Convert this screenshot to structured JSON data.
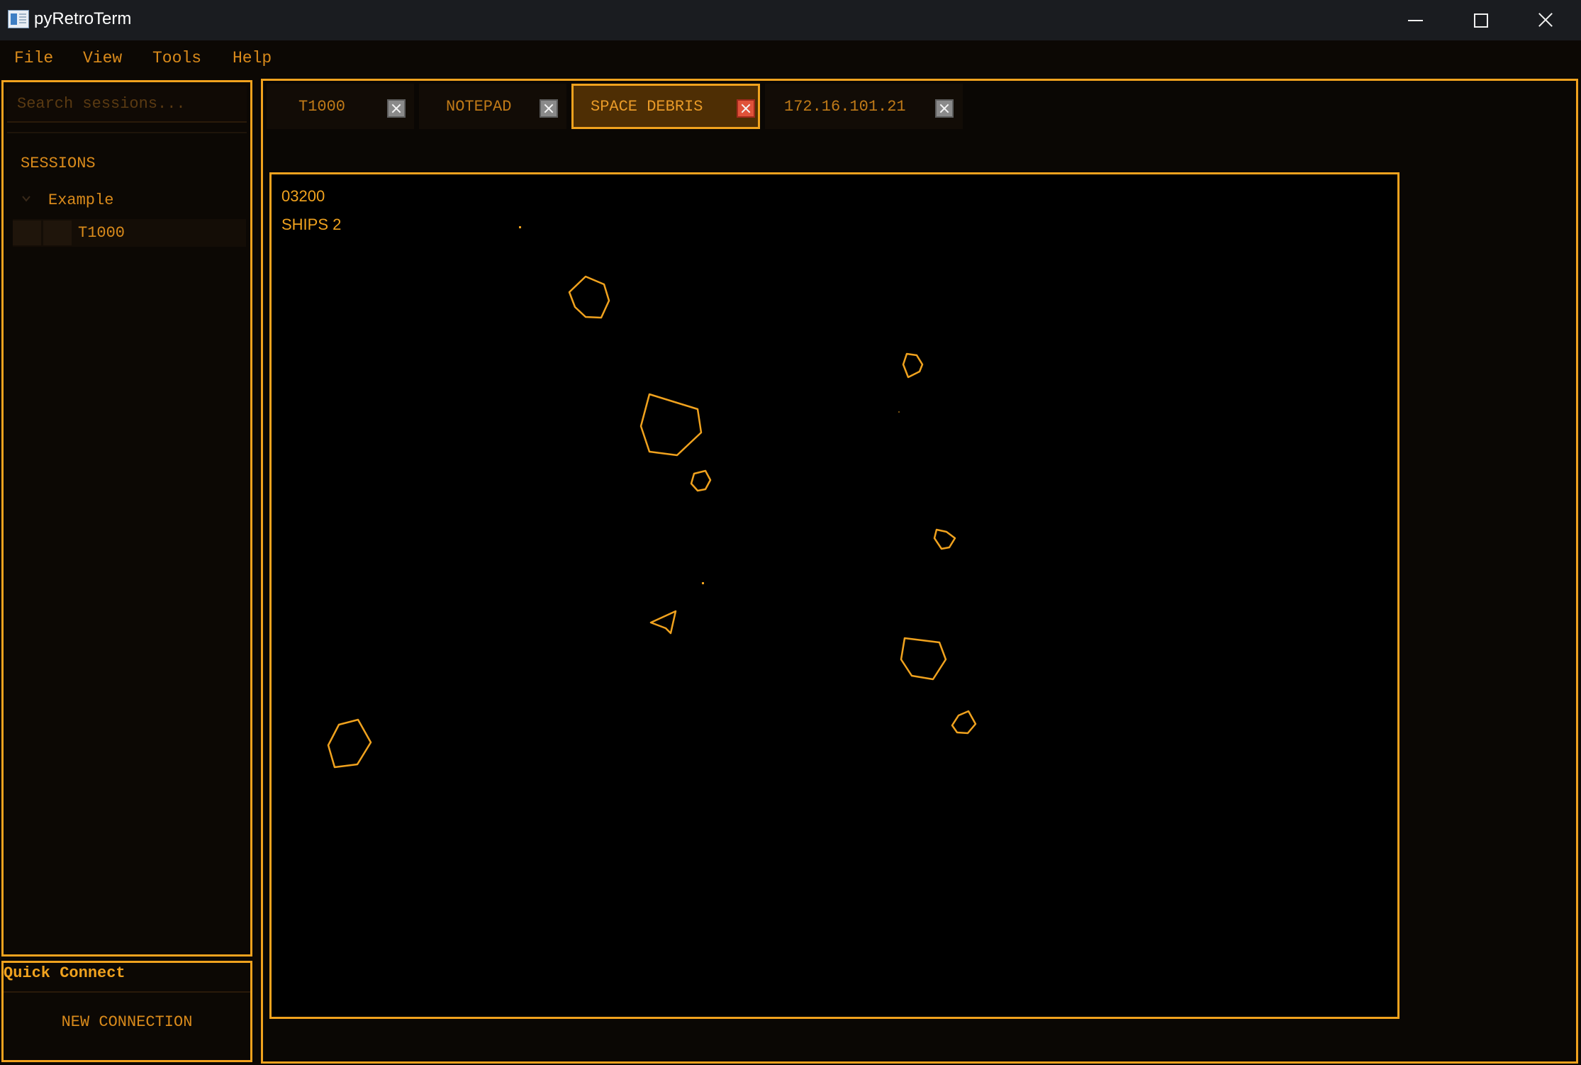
{
  "window": {
    "title": "pyRetroTerm"
  },
  "menu": {
    "file": "File",
    "view": "View",
    "tools": "Tools",
    "help": "Help"
  },
  "sidebar": {
    "search_placeholder": "Search sessions...",
    "sessions_heading": "SESSIONS",
    "folder_label": "Example",
    "session_item": "T1000"
  },
  "quick_connect": {
    "title": "Quick Connect",
    "button": "NEW CONNECTION"
  },
  "tabs": [
    {
      "label": "T1000",
      "active": false
    },
    {
      "label": "NOTEPAD",
      "active": false
    },
    {
      "label": "SPACE DEBRIS",
      "active": true
    },
    {
      "label": "172.16.101.21",
      "active": false
    }
  ],
  "game": {
    "score": "03200",
    "ships": "SHIPS 2"
  },
  "colors": {
    "accent": "#f0a21e",
    "text": "#d98a1b",
    "background": "#0c0804",
    "active_tab": "#4e2e04",
    "active_close": "#e0523a"
  },
  "icons": {
    "app": "terminal-app-icon",
    "close_tab": "close-x-icon",
    "folder_toggle": "chevron-down-icon",
    "ship": "player-ship-icon",
    "debris": "asteroid-outline-icon"
  }
}
